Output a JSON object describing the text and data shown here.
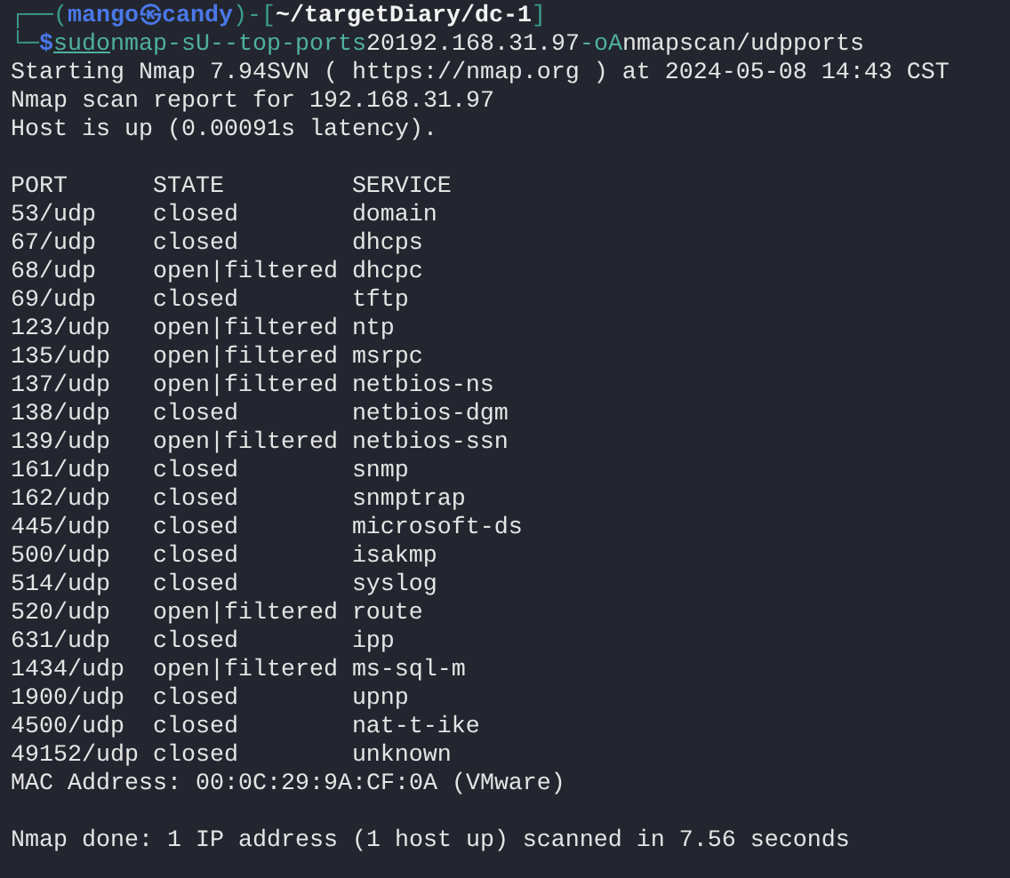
{
  "prompt": {
    "segments": [
      {
        "text": "┌──(",
        "kind": "frame"
      },
      {
        "text": "mango㉿candy",
        "kind": "user"
      },
      {
        "text": ")-[",
        "kind": "frame"
      },
      {
        "text": "~/targetDiary/dc-1",
        "kind": "path"
      },
      {
        "text": "]",
        "kind": "frame"
      }
    ],
    "frame": "└─",
    "symbol": "$",
    "words": [
      {
        "text": "sudo",
        "kind": "sudo"
      },
      {
        "text": "nmap",
        "kind": "command"
      },
      {
        "text": "-sU",
        "kind": "option"
      },
      {
        "text": "--top-ports",
        "kind": "option"
      },
      {
        "text": "20",
        "kind": "argument"
      },
      {
        "text": "192.168.31.97",
        "kind": "argument"
      },
      {
        "text": "-oA",
        "kind": "option"
      },
      {
        "text": "nmapscan/udpports",
        "kind": "argument"
      }
    ]
  },
  "output_head": [
    "Starting Nmap 7.94SVN ( https://nmap.org ) at 2024-05-08 14:43 CST",
    "Nmap scan report for 192.168.31.97",
    "Host is up (0.00091s latency)."
  ],
  "table": {
    "columns": [
      "PORT",
      "STATE",
      "SERVICE"
    ],
    "rows": [
      {
        "port": "53/udp",
        "state": "closed",
        "service": "domain"
      },
      {
        "port": "67/udp",
        "state": "closed",
        "service": "dhcps"
      },
      {
        "port": "68/udp",
        "state": "open|filtered",
        "service": "dhcpc"
      },
      {
        "port": "69/udp",
        "state": "closed",
        "service": "tftp"
      },
      {
        "port": "123/udp",
        "state": "open|filtered",
        "service": "ntp"
      },
      {
        "port": "135/udp",
        "state": "open|filtered",
        "service": "msrpc"
      },
      {
        "port": "137/udp",
        "state": "open|filtered",
        "service": "netbios-ns"
      },
      {
        "port": "138/udp",
        "state": "closed",
        "service": "netbios-dgm"
      },
      {
        "port": "139/udp",
        "state": "open|filtered",
        "service": "netbios-ssn"
      },
      {
        "port": "161/udp",
        "state": "closed",
        "service": "snmp"
      },
      {
        "port": "162/udp",
        "state": "closed",
        "service": "snmptrap"
      },
      {
        "port": "445/udp",
        "state": "closed",
        "service": "microsoft-ds"
      },
      {
        "port": "500/udp",
        "state": "closed",
        "service": "isakmp"
      },
      {
        "port": "514/udp",
        "state": "closed",
        "service": "syslog"
      },
      {
        "port": "520/udp",
        "state": "open|filtered",
        "service": "route"
      },
      {
        "port": "631/udp",
        "state": "closed",
        "service": "ipp"
      },
      {
        "port": "1434/udp",
        "state": "open|filtered",
        "service": "ms-sql-m"
      },
      {
        "port": "1900/udp",
        "state": "closed",
        "service": "upnp"
      },
      {
        "port": "4500/udp",
        "state": "closed",
        "service": "nat-t-ike"
      },
      {
        "port": "49152/udp",
        "state": "closed",
        "service": "unknown"
      }
    ]
  },
  "mac_line": "MAC Address: 00:0C:29:9A:CF:0A (VMware)",
  "done_line": "Nmap done: 1 IP address (1 host up) scanned in 7.56 seconds"
}
